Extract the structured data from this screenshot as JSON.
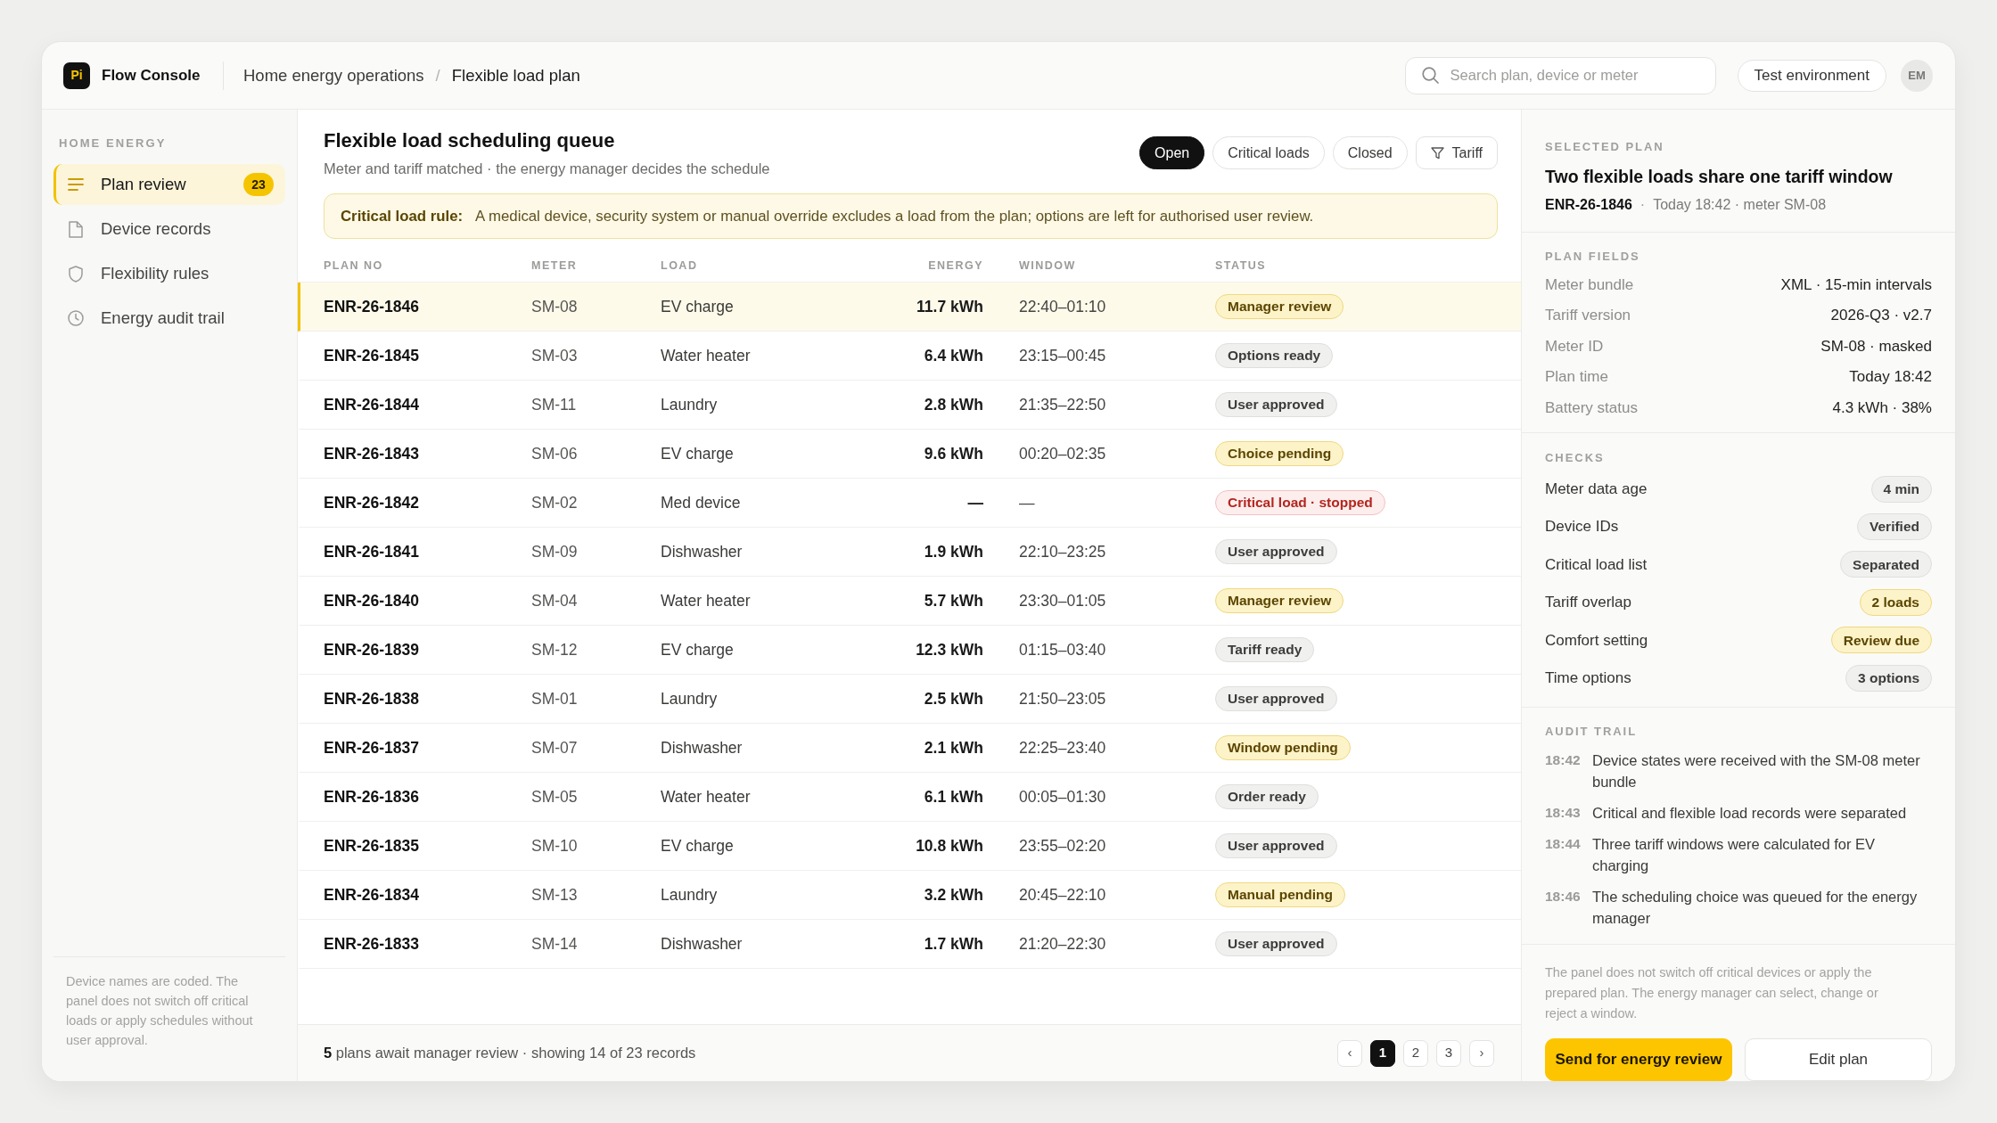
{
  "app": {
    "logo_text": "Pi",
    "name": "Flow Console"
  },
  "breadcrumb": {
    "items": [
      "Home energy operations",
      "Flexible load plan"
    ],
    "separator": "/"
  },
  "search": {
    "placeholder": "Search plan, device or meter"
  },
  "environment_button": "Test environment",
  "avatar": "EM",
  "sidebar": {
    "heading": "HOME ENERGY",
    "items": [
      {
        "label": "Plan review",
        "selected": true,
        "count": "23"
      },
      {
        "label": "Device records",
        "selected": false
      },
      {
        "label": "Flexibility rules",
        "selected": false
      },
      {
        "label": "Energy audit trail",
        "selected": false
      }
    ],
    "note": "Device names are coded. The panel does not switch off critical loads or apply schedules without user approval."
  },
  "queue": {
    "title": "Flexible load scheduling queue",
    "subtitle": "Meter and tariff matched · the energy manager decides the schedule",
    "filters": [
      {
        "label": "Open",
        "selected": true,
        "kind": "status"
      },
      {
        "label": "Critical loads",
        "selected": false,
        "kind": "status"
      },
      {
        "label": "Closed",
        "selected": false,
        "kind": "status"
      },
      {
        "label": "Tariff",
        "selected": false,
        "kind": "filter"
      }
    ],
    "notice": {
      "label": "Critical load rule:",
      "text": "A medical device, security system or manual override excludes a load from the plan; options are left for authorised user review."
    },
    "table": {
      "columns": [
        "PLAN NO",
        "METER",
        "LOAD",
        "ENERGY",
        "WINDOW",
        "STATUS"
      ],
      "rows": [
        {
          "plan_no": "ENR-26-1846",
          "meter": "SM-08",
          "load": "EV charge",
          "energy": "11.7 kWh",
          "window": "22:40–01:10",
          "status": {
            "label": "Manager review",
            "kind": "attention"
          },
          "selected": true
        },
        {
          "plan_no": "ENR-26-1845",
          "meter": "SM-03",
          "load": "Water heater",
          "energy": "6.4 kWh",
          "window": "23:15–00:45",
          "status": {
            "label": "Options ready",
            "kind": "neutral"
          },
          "selected": false
        },
        {
          "plan_no": "ENR-26-1844",
          "meter": "SM-11",
          "load": "Laundry",
          "energy": "2.8 kWh",
          "window": "21:35–22:50",
          "status": {
            "label": "User approved",
            "kind": "neutral"
          },
          "selected": false
        },
        {
          "plan_no": "ENR-26-1843",
          "meter": "SM-06",
          "load": "EV charge",
          "energy": "9.6 kWh",
          "window": "00:20–02:35",
          "status": {
            "label": "Choice pending",
            "kind": "attention"
          },
          "selected": false
        },
        {
          "plan_no": "ENR-26-1842",
          "meter": "SM-02",
          "load": "Med device",
          "energy": "—",
          "window": "—",
          "status": {
            "label": "Critical load · stopped",
            "kind": "critical"
          },
          "selected": false
        },
        {
          "plan_no": "ENR-26-1841",
          "meter": "SM-09",
          "load": "Dishwasher",
          "energy": "1.9 kWh",
          "window": "22:10–23:25",
          "status": {
            "label": "User approved",
            "kind": "neutral"
          },
          "selected": false
        },
        {
          "plan_no": "ENR-26-1840",
          "meter": "SM-04",
          "load": "Water heater",
          "energy": "5.7 kWh",
          "window": "23:30–01:05",
          "status": {
            "label": "Manager review",
            "kind": "attention"
          },
          "selected": false
        },
        {
          "plan_no": "ENR-26-1839",
          "meter": "SM-12",
          "load": "EV charge",
          "energy": "12.3 kWh",
          "window": "01:15–03:40",
          "status": {
            "label": "Tariff ready",
            "kind": "neutral"
          },
          "selected": false
        },
        {
          "plan_no": "ENR-26-1838",
          "meter": "SM-01",
          "load": "Laundry",
          "energy": "2.5 kWh",
          "window": "21:50–23:05",
          "status": {
            "label": "User approved",
            "kind": "neutral"
          },
          "selected": false
        },
        {
          "plan_no": "ENR-26-1837",
          "meter": "SM-07",
          "load": "Dishwasher",
          "energy": "2.1 kWh",
          "window": "22:25–23:40",
          "status": {
            "label": "Window pending",
            "kind": "attention"
          },
          "selected": false
        },
        {
          "plan_no": "ENR-26-1836",
          "meter": "SM-05",
          "load": "Water heater",
          "energy": "6.1 kWh",
          "window": "00:05–01:30",
          "status": {
            "label": "Order ready",
            "kind": "neutral"
          },
          "selected": false
        },
        {
          "plan_no": "ENR-26-1835",
          "meter": "SM-10",
          "load": "EV charge",
          "energy": "10.8 kWh",
          "window": "23:55–02:20",
          "status": {
            "label": "User approved",
            "kind": "neutral"
          },
          "selected": false
        },
        {
          "plan_no": "ENR-26-1834",
          "meter": "SM-13",
          "load": "Laundry",
          "energy": "3.2 kWh",
          "window": "20:45–22:10",
          "status": {
            "label": "Manual pending",
            "kind": "attention"
          },
          "selected": false
        },
        {
          "plan_no": "ENR-26-1833",
          "meter": "SM-14",
          "load": "Dishwasher",
          "energy": "1.7 kWh",
          "window": "21:20–22:30",
          "status": {
            "label": "User approved",
            "kind": "neutral"
          },
          "selected": false
        }
      ]
    },
    "footer": {
      "summary": "**5** plans await manager review · showing 14 of 23 records",
      "pagination": {
        "prev": "‹",
        "pages": [
          {
            "label": "1",
            "selected": true
          },
          {
            "label": "2",
            "selected": false
          },
          {
            "label": "3",
            "selected": false
          }
        ],
        "next": "›"
      }
    }
  },
  "details": {
    "heading": "SELECTED PLAN",
    "title": "Two flexible loads share one tariff window",
    "plan_id": "ENR-26-1846",
    "separator": "·",
    "meta": "Today 18:42 · meter SM-08",
    "fields": {
      "heading": "PLAN FIELDS",
      "rows": [
        {
          "label": "Meter bundle",
          "value": "XML · 15-min intervals"
        },
        {
          "label": "Tariff version",
          "value": "2026-Q3 · v2.7"
        },
        {
          "label": "Meter ID",
          "value": "SM-08 · masked"
        },
        {
          "label": "Plan time",
          "value": "Today 18:42"
        },
        {
          "label": "Battery status",
          "value": "4.3 kWh · 38%"
        }
      ]
    },
    "checks": {
      "heading": "CHECKS",
      "rows": [
        {
          "label": "Meter data age",
          "value": "4 min",
          "kind": "neutral"
        },
        {
          "label": "Device IDs",
          "value": "Verified",
          "kind": "neutral"
        },
        {
          "label": "Critical load list",
          "value": "Separated",
          "kind": "neutral"
        },
        {
          "label": "Tariff overlap",
          "value": "2 loads",
          "kind": "attention"
        },
        {
          "label": "Comfort setting",
          "value": "Review due",
          "kind": "attention"
        },
        {
          "label": "Time options",
          "value": "3 options",
          "kind": "neutral"
        }
      ]
    },
    "audit": {
      "heading": "AUDIT TRAIL",
      "entries": [
        {
          "time": "18:42",
          "text": "Device states were received with the SM-08 meter bundle"
        },
        {
          "time": "18:43",
          "text": "Critical and flexible load records were separated"
        },
        {
          "time": "18:44",
          "text": "Three tariff windows were calculated for EV charging"
        },
        {
          "time": "18:46",
          "text": "The scheduling choice was queued for the energy manager"
        }
      ]
    },
    "note": "The panel does not switch off critical devices or apply the prepared plan. The energy manager can select, change or reject a window.",
    "actions": [
      {
        "label": "Send for energy review",
        "kind": "primary"
      },
      {
        "label": "Edit plan",
        "kind": "secondary"
      }
    ]
  }
}
